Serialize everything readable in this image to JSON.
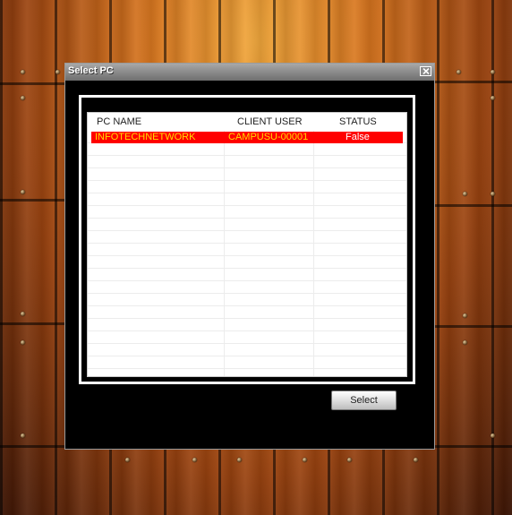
{
  "dialog": {
    "title": "Select PC",
    "close_icon": "close-icon",
    "select_label": "Select"
  },
  "table": {
    "columns": [
      "PC NAME",
      "CLIENT USER",
      "STATUS"
    ],
    "rows": [
      {
        "pc_name": "INFOTECHNETWORK",
        "client_user": "CAMPUSU-00001",
        "status": "False"
      }
    ],
    "selected_row_color": "#ff0000",
    "selected_text_color": "#ffdd00"
  }
}
